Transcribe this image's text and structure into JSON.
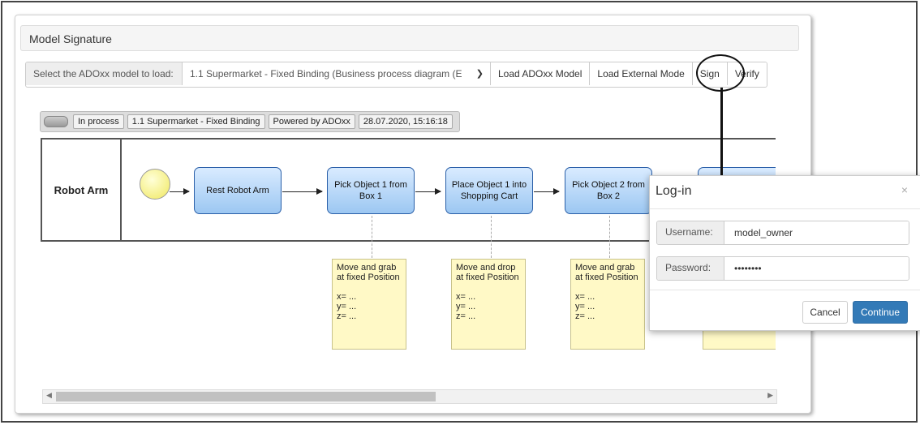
{
  "panel": {
    "title": "Model Signature"
  },
  "toolbar": {
    "select_label": "Select the ADOxx model to load:",
    "select_value": "1.1 Supermarket - Fixed Binding (Business process diagram (E",
    "load_adoxx": "Load ADOxx Model",
    "load_external": "Load External Mode",
    "sign": "Sign",
    "verify": "Verify"
  },
  "status_bar": {
    "state": "In process",
    "model": "1.1 Supermarket - Fixed Binding",
    "powered": "Powered by ADOxx",
    "timestamp": "28.07.2020, 15:16:18"
  },
  "diagram": {
    "lane_label": "Robot Arm",
    "tasks": [
      "Rest Robot Arm",
      "Pick Object 1 from Box 1",
      "Place Object 1 into Shopping Cart",
      "Pick Object 2 from Box 2"
    ],
    "notes": [
      "Move and grab\nat fixed Position\n\nx= ...\ny= ...\nz= ...",
      "Move and drop\nat fixed Position\n\nx= ...\ny= ...\nz= ...",
      "Move and grab\nat fixed Position\n\nx= ...\ny= ...\nz= ..."
    ]
  },
  "login": {
    "title": "Log-in",
    "close": "×",
    "username_label": "Username:",
    "username_value": "model_owner",
    "password_label": "Password:",
    "password_value": "model_pw",
    "cancel": "Cancel",
    "continue": "Continue"
  }
}
